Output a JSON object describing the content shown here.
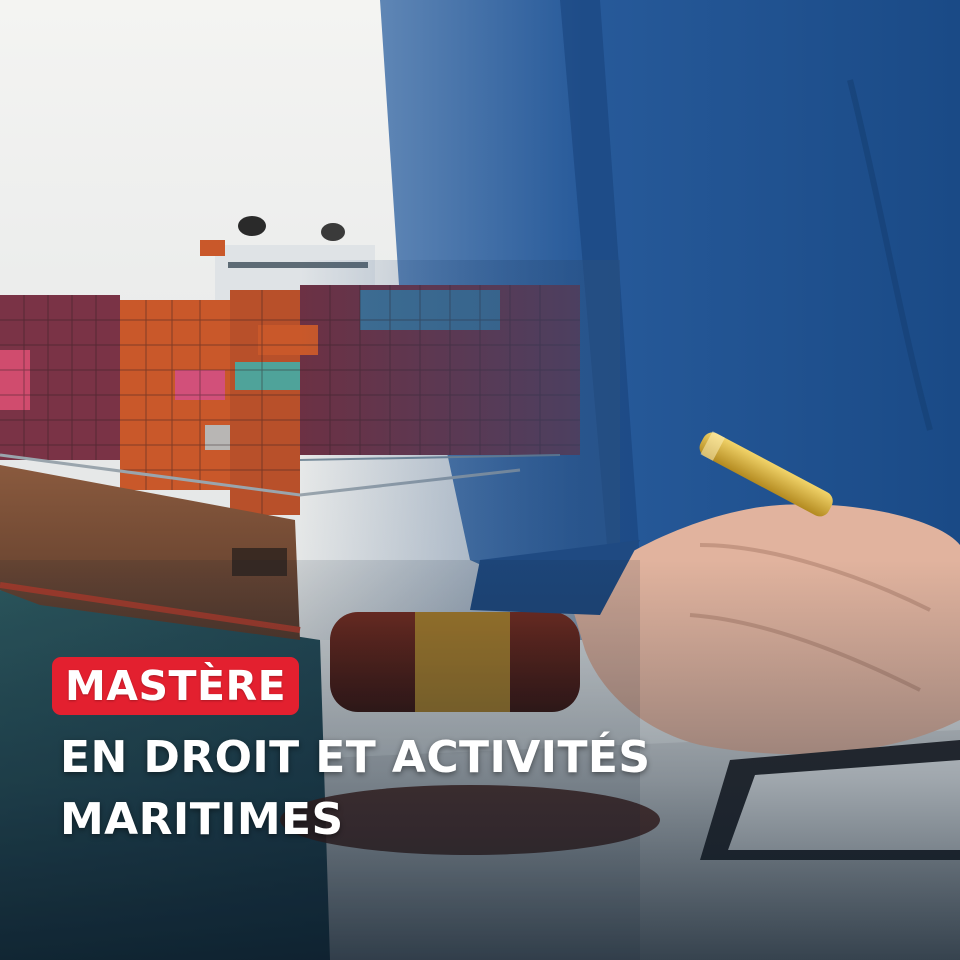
{
  "badge": {
    "text": "MASTÈRE"
  },
  "title": {
    "line1": "EN DROIT ET ACTIVITÉS",
    "line2": "MARITIMES"
  },
  "colors": {
    "badge_red": "#e3202f",
    "suit_blue": "#1f4f8f",
    "sea": "#28535a",
    "container_orange": "#c9582a",
    "pen_gold": "#c9a12e"
  },
  "icons": [
    "container-ship-image",
    "businessman-hand-image",
    "gold-pen-image",
    "gavel-image"
  ]
}
